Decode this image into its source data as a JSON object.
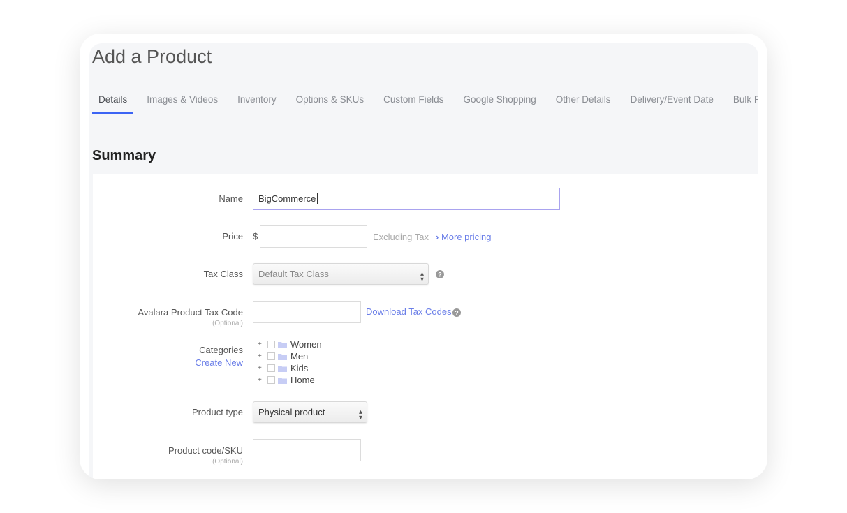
{
  "page": {
    "title": "Add a Product",
    "section": "Summary"
  },
  "tabs": [
    {
      "label": "Details",
      "active": true
    },
    {
      "label": "Images & Videos"
    },
    {
      "label": "Inventory"
    },
    {
      "label": "Options & SKUs"
    },
    {
      "label": "Custom Fields"
    },
    {
      "label": "Google Shopping"
    },
    {
      "label": "Other Details"
    },
    {
      "label": "Delivery/Event Date"
    },
    {
      "label": "Bulk Pricing"
    }
  ],
  "form": {
    "name": {
      "label": "Name",
      "value": "BigCommerce"
    },
    "price": {
      "label": "Price",
      "currency": "$",
      "value": "",
      "note": "Excluding Tax",
      "more_link": "More pricing"
    },
    "tax_class": {
      "label": "Tax Class",
      "value": "Default Tax Class",
      "help_icon": "question-circle-icon"
    },
    "avalara": {
      "label": "Avalara Product Tax Code",
      "optional": "(Optional)",
      "value": "",
      "link": "Download Tax Codes"
    },
    "categories": {
      "label": "Categories",
      "create_link": "Create New",
      "items": [
        "Women",
        "Men",
        "Kids",
        "Home"
      ]
    },
    "product_type": {
      "label": "Product type",
      "value": "Physical product"
    },
    "sku": {
      "label": "Product code/SKU",
      "optional": "(Optional)",
      "value": ""
    }
  },
  "colors": {
    "accent": "#3c64f4",
    "link": "#6a7ee8",
    "focus_border": "#a9a3ef"
  }
}
